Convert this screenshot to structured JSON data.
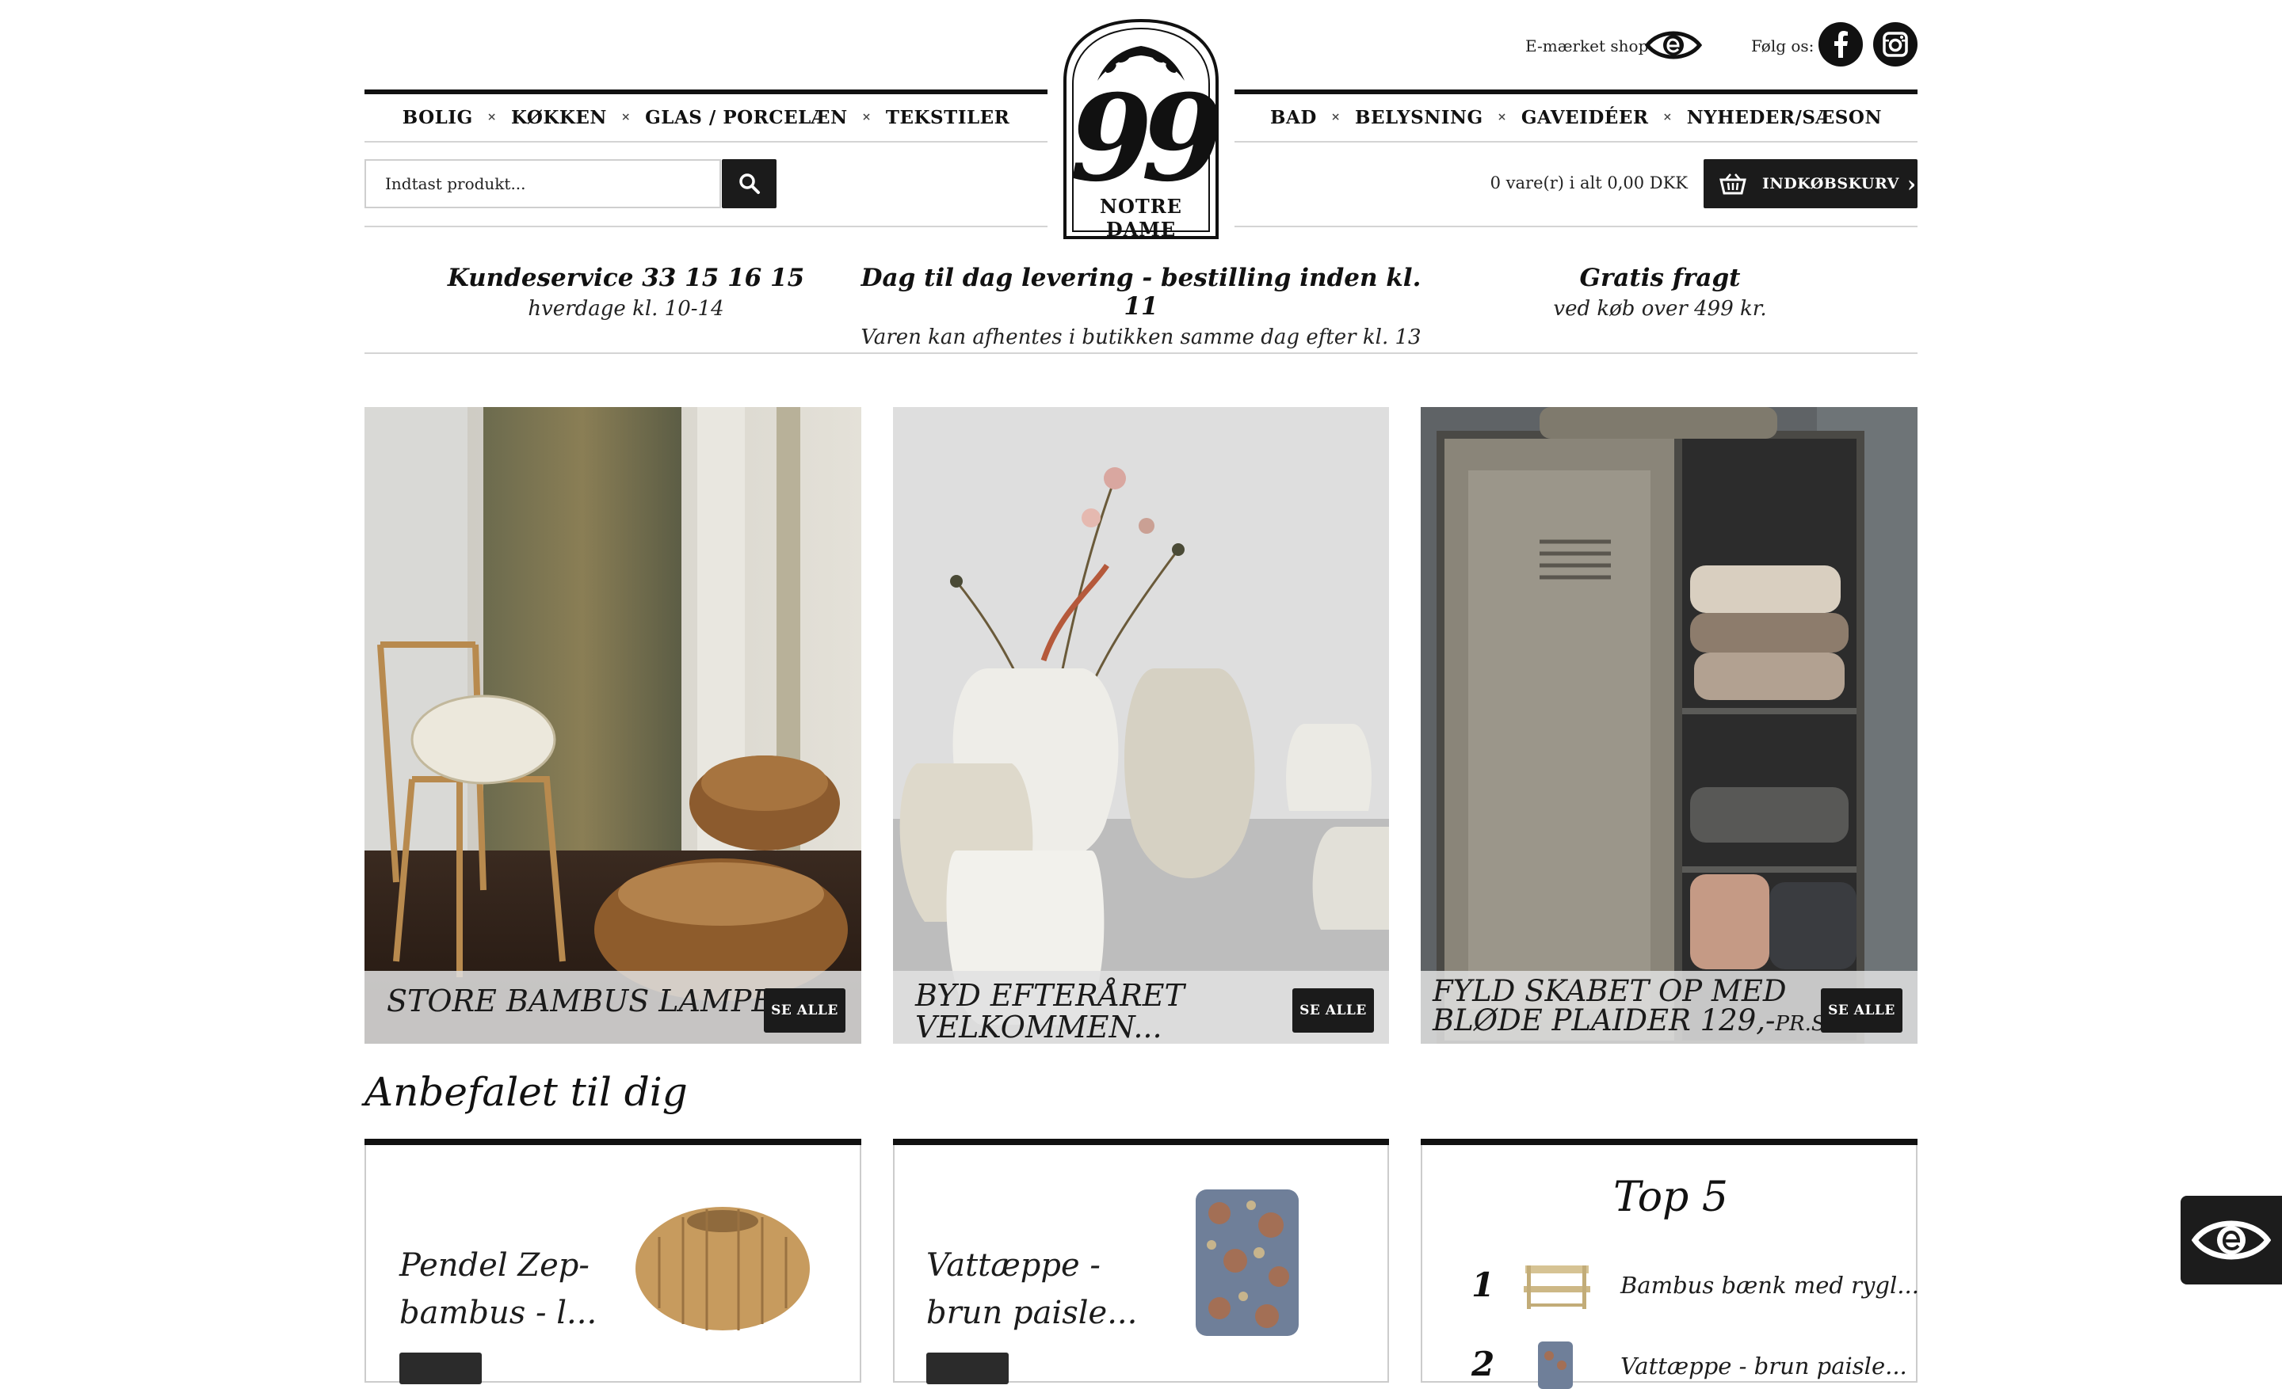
{
  "header": {
    "emark_label": "E-mærket shop",
    "follow_label": "Følg os:",
    "logo_text": "NOTRE DAME",
    "logo_numerals": "99"
  },
  "nav_left": [
    {
      "label": "BOLIG"
    },
    {
      "label": "KØKKEN"
    },
    {
      "label": "GLAS / PORCELÆN"
    },
    {
      "label": "TEKSTILER"
    }
  ],
  "nav_right": [
    {
      "label": "BAD"
    },
    {
      "label": "BELYSNING"
    },
    {
      "label": "GAVEIDÉER"
    },
    {
      "label": "NYHEDER/SÆSON"
    }
  ],
  "nav_separator": "×",
  "search": {
    "placeholder": "Indtast produkt..."
  },
  "cart": {
    "summary": "0 vare(r) i alt 0,00 DKK",
    "button_label": "INDKØBSKURV",
    "chevron": "›"
  },
  "usps": [
    {
      "title": "Kundeservice 33 15 16 15",
      "subtitle": "hverdage kl. 10-14"
    },
    {
      "title": "Dag til dag levering - bestilling inden kl. 11",
      "subtitle": "Varen kan afhentes i butikken samme dag efter kl. 13"
    },
    {
      "title": "Gratis fragt",
      "subtitle": "ved køb over 499 kr."
    }
  ],
  "promos": [
    {
      "title_line1": "STORE BAMBUS LAMPER",
      "title_line2": "",
      "button": "SE ALLE"
    },
    {
      "title_line1": "BYD EFTERÅRET",
      "title_line2": "VELKOMMEN...",
      "button": "SE ALLE"
    },
    {
      "title_line1": "FYLD SKABET OP MED",
      "title_line2": "BLØDE PLAIDER 129,-",
      "title_suffix": "PR.STK.",
      "button": "SE ALLE"
    }
  ],
  "recommended": {
    "heading": "Anbefalet til dig",
    "products": [
      {
        "line1": "Pendel Zep-",
        "line2": "bambus - l..."
      },
      {
        "line1": "Vattæppe -",
        "line2": "brun paisle..."
      }
    ],
    "top5": {
      "title": "Top 5",
      "items": [
        {
          "rank": "1",
          "name": "Bambus bænk med rygl..."
        },
        {
          "rank": "2",
          "name": "Vattæppe - brun paisle..."
        }
      ]
    }
  },
  "colors": {
    "accent": "#111111",
    "divider": "#d4d4d4"
  }
}
